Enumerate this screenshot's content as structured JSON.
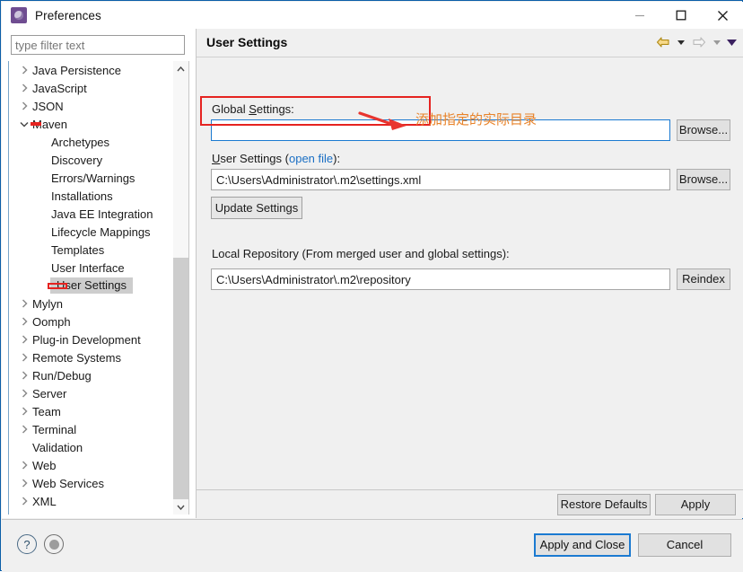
{
  "window": {
    "title": "Preferences",
    "app_icon": "preferences-gear-icon",
    "minimize_label": "Minimize",
    "maximize_label": "Maximize",
    "close_label": "Close"
  },
  "filter": {
    "placeholder": "type filter text",
    "value": ""
  },
  "tree": {
    "items": [
      {
        "label": "Java Persistence",
        "level": 1,
        "expandable": true,
        "expanded": false,
        "selected": false
      },
      {
        "label": "JavaScript",
        "level": 1,
        "expandable": true,
        "expanded": false,
        "selected": false
      },
      {
        "label": "JSON",
        "level": 1,
        "expandable": true,
        "expanded": false,
        "selected": false
      },
      {
        "label": "Maven",
        "level": 1,
        "expandable": true,
        "expanded": true,
        "selected": false
      },
      {
        "label": "Archetypes",
        "level": 2,
        "expandable": false,
        "expanded": false,
        "selected": false
      },
      {
        "label": "Discovery",
        "level": 2,
        "expandable": false,
        "expanded": false,
        "selected": false
      },
      {
        "label": "Errors/Warnings",
        "level": 2,
        "expandable": false,
        "expanded": false,
        "selected": false
      },
      {
        "label": "Installations",
        "level": 2,
        "expandable": false,
        "expanded": false,
        "selected": false
      },
      {
        "label": "Java EE Integration",
        "level": 2,
        "expandable": false,
        "expanded": false,
        "selected": false
      },
      {
        "label": "Lifecycle Mappings",
        "level": 2,
        "expandable": false,
        "expanded": false,
        "selected": false
      },
      {
        "label": "Templates",
        "level": 2,
        "expandable": false,
        "expanded": false,
        "selected": false
      },
      {
        "label": "User Interface",
        "level": 2,
        "expandable": false,
        "expanded": false,
        "selected": false
      },
      {
        "label": "User Settings",
        "level": 2,
        "expandable": false,
        "expanded": false,
        "selected": true
      },
      {
        "label": "Mylyn",
        "level": 1,
        "expandable": true,
        "expanded": false,
        "selected": false
      },
      {
        "label": "Oomph",
        "level": 1,
        "expandable": true,
        "expanded": false,
        "selected": false
      },
      {
        "label": "Plug-in Development",
        "level": 1,
        "expandable": true,
        "expanded": false,
        "selected": false
      },
      {
        "label": "Remote Systems",
        "level": 1,
        "expandable": true,
        "expanded": false,
        "selected": false
      },
      {
        "label": "Run/Debug",
        "level": 1,
        "expandable": true,
        "expanded": false,
        "selected": false
      },
      {
        "label": "Server",
        "level": 1,
        "expandable": true,
        "expanded": false,
        "selected": false
      },
      {
        "label": "Team",
        "level": 1,
        "expandable": true,
        "expanded": false,
        "selected": false
      },
      {
        "label": "Terminal",
        "level": 1,
        "expandable": true,
        "expanded": false,
        "selected": false
      },
      {
        "label": "Validation",
        "level": 1,
        "expandable": false,
        "expanded": false,
        "selected": false
      },
      {
        "label": "Web",
        "level": 1,
        "expandable": true,
        "expanded": false,
        "selected": false
      },
      {
        "label": "Web Services",
        "level": 1,
        "expandable": true,
        "expanded": false,
        "selected": false
      },
      {
        "label": "XML",
        "level": 1,
        "expandable": true,
        "expanded": false,
        "selected": false
      }
    ]
  },
  "panel": {
    "title": "User Settings",
    "nav": {
      "back_icon": "back-arrow-icon",
      "back_dropdown_icon": "chevron-down-icon",
      "forward_icon": "forward-arrow-icon",
      "forward_dropdown_icon": "chevron-down-icon",
      "menu_icon": "view-menu-chevron-icon"
    },
    "global_settings": {
      "label_pre": "Global ",
      "label_mnemonic": "S",
      "label_post": "ettings:",
      "value": "",
      "placeholder": "",
      "browse_label": "Browse..."
    },
    "user_settings": {
      "label_mnemonic": "U",
      "label_pre": "ser Settings (",
      "link_text": "open file",
      "label_post": "):",
      "value": "C:\\Users\\Administrator\\.m2\\settings.xml",
      "browse_label": "Browse...",
      "update_label": "Update Settings"
    },
    "local_repository": {
      "label": "Local Repository (From merged user and global settings):",
      "value": "C:\\Users\\Administrator\\.m2\\repository",
      "reindex_label": "Reindex"
    },
    "restore_defaults_label": "Restore Defaults",
    "apply_label": "Apply"
  },
  "annotations": {
    "note_text": "添加指定的实际目录",
    "note_color": "#E8832A",
    "box_color": "#E52320",
    "arrow_color": "#E8352F"
  },
  "footer": {
    "help_icon": "question-mark-help-icon",
    "home_icon": "oomph-record-icon",
    "apply_and_close_label": "Apply and Close",
    "cancel_label": "Cancel"
  }
}
